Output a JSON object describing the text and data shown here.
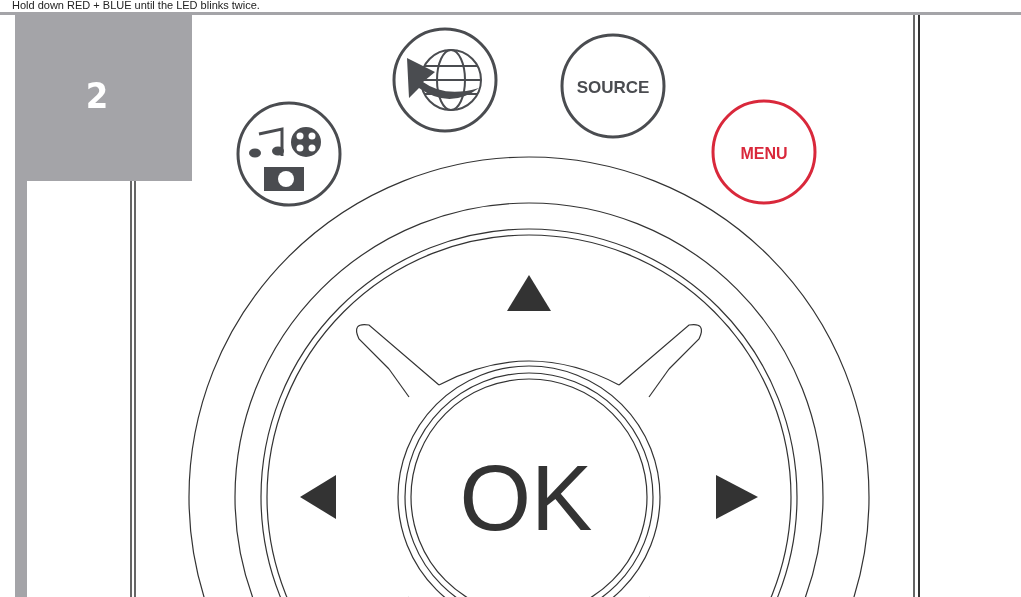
{
  "instruction": "Hold down RED + BLUE until the LED blinks twice.",
  "step": {
    "number": "2"
  },
  "buttons": [
    {
      "kind": "media",
      "color": "#4a4c50"
    },
    {
      "kind": "globe",
      "color": "#4a4c50"
    },
    {
      "kind": "text",
      "label": "SOURCE",
      "color": "#4a4c50"
    },
    {
      "kind": "text",
      "label": "MENU",
      "color": "#d9283b"
    }
  ],
  "dpad": {
    "ok": "OK"
  }
}
